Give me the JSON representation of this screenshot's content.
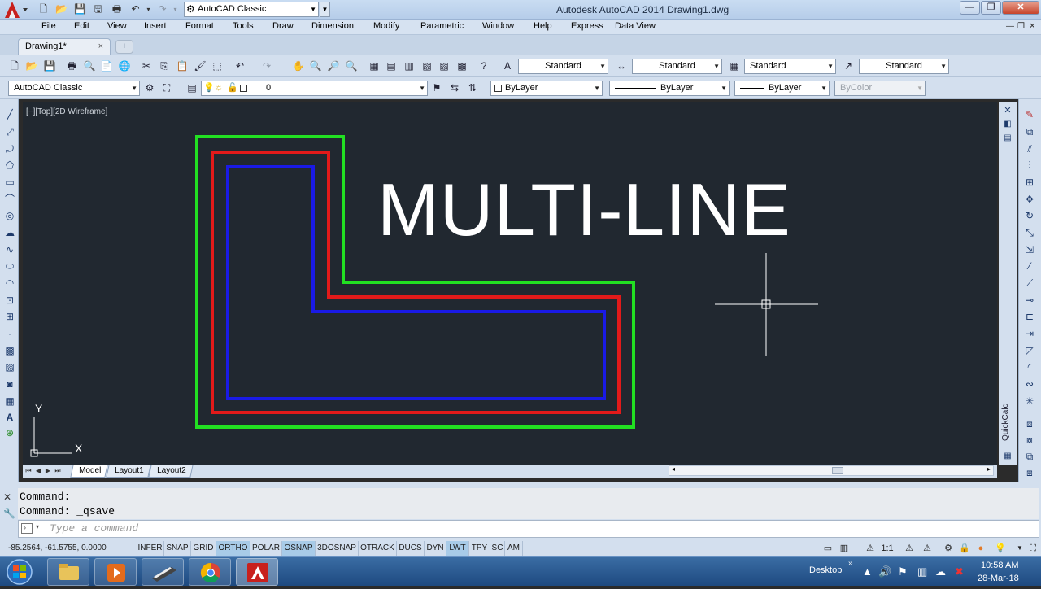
{
  "window": {
    "title": "Autodesk AutoCAD 2014    Drawing1.dwg",
    "workspace": "AutoCAD Classic"
  },
  "menu": [
    "File",
    "Edit",
    "View",
    "Insert",
    "Format",
    "Tools",
    "Draw",
    "Dimension",
    "Modify",
    "Parametric",
    "Window",
    "Help",
    "Express",
    "Data View"
  ],
  "tabs": {
    "file_tab": "Drawing1*",
    "close_glyph": "×",
    "new_tab_glyph": "+"
  },
  "toolbar1": {
    "text_style": "Standard",
    "dim_style": "Standard",
    "table_style": "Standard",
    "mleader_style": "Standard"
  },
  "toolbar2": {
    "workspace": "AutoCAD Classic",
    "layer": "0",
    "color": "ByLayer",
    "linetype": "ByLayer",
    "lineweight": "ByLayer",
    "plotstyle": "ByColor"
  },
  "viewport": {
    "label": "[−][Top][2D Wireframe]",
    "drawing_text": "MULTI-LINE",
    "ucs_x": "X",
    "ucs_y": "Y",
    "colors": {
      "background": "#212830",
      "outer": "#22e022",
      "middle": "#e21a1a",
      "inner": "#1a1ae6",
      "text": "#ffffff"
    }
  },
  "side_panel": {
    "quickcalc": "QuickCalc"
  },
  "layouts": [
    "Model",
    "Layout1",
    "Layout2"
  ],
  "command": {
    "history": [
      "Command:",
      "Command: _qsave"
    ],
    "placeholder": "Type a command"
  },
  "status": {
    "coords": "-85.2564, -61.5755, 0.0000",
    "toggles": [
      {
        "label": "INFER",
        "on": false
      },
      {
        "label": "SNAP",
        "on": false
      },
      {
        "label": "GRID",
        "on": false
      },
      {
        "label": "ORTHO",
        "on": true
      },
      {
        "label": "POLAR",
        "on": false
      },
      {
        "label": "OSNAP",
        "on": true
      },
      {
        "label": "3DOSNAP",
        "on": false
      },
      {
        "label": "OTRACK",
        "on": false
      },
      {
        "label": "DUCS",
        "on": false
      },
      {
        "label": "DYN",
        "on": false
      },
      {
        "label": "LWT",
        "on": true
      },
      {
        "label": "TPY",
        "on": false
      },
      {
        "label": "SC",
        "on": false
      },
      {
        "label": "AM",
        "on": false
      }
    ],
    "annotation_scale": "1:1"
  },
  "taskbar": {
    "desktop": "Desktop",
    "chevron": "»",
    "time": "10:58 AM",
    "date": "28-Mar-18"
  }
}
